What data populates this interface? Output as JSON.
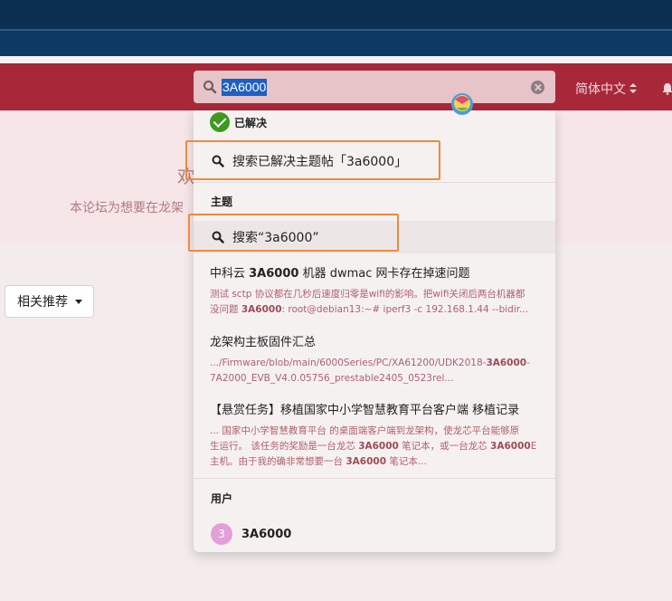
{
  "header": {
    "search": {
      "value": "3A6000"
    },
    "language": "简体中文"
  },
  "banner": {
    "title": "欢迎",
    "subtitle": "本论坛为想要在龙架"
  },
  "sort_button": {
    "label": "相关推荐"
  },
  "dropdown": {
    "solved_label": "已解决",
    "search_solved": "搜索已解决主题帖「3a6000」",
    "topics_heading": "主题",
    "search_topics": "搜索“3a6000”",
    "topics": [
      {
        "title_before": "中科云 ",
        "title_match": "3A6000",
        "title_after": " 机器 dwmac 网卡存在掉速问题",
        "line1": "测试 sctp 协议都在几秒后速度归零是wifi的影响。把wifi关闭后两台机器都",
        "line2_before": "没问题 ",
        "line2_match": "3A6000",
        "line2_after": ": root@debian13:~# iperf3 -c 192.168.1.44 --bidir..."
      },
      {
        "title": "龙架构主板固件汇总",
        "line1_before": ".../Firmware/blob/main/6000Series/PC/XA61200/UDK2018-",
        "line1_match": "3A6000",
        "line1_after": "-",
        "line2": "7A2000_EVB_V4.0.05756_prestable2405_0523rel..."
      },
      {
        "title": "【悬赏任务】移植国家中小学智慧教育平台客户端 移植记录",
        "line1": "... 国家中小学智慧教育平台 的桌面端客户端到龙架构，使龙芯平台能够原",
        "line2_before": "生运行。 该任务的奖励是一台龙芯 ",
        "line2_match": "3A6000",
        "line2_mid": " 笔记本，或一台龙芯 ",
        "line2_match2": "3A6000",
        "line2_after": "E",
        "line3_before": "主机。由于我的确非常想要一台 ",
        "line3_match": "3A6000",
        "line3_after": " 笔记本..."
      }
    ],
    "users_heading": "用户",
    "user": {
      "avatar": "3",
      "name": "3A6000"
    }
  },
  "colors": {
    "header_red": "#a8283a",
    "top_navy": "#0b2f50",
    "highlight_orange": "#ef8a3c",
    "solved_green": "#3d9a1f",
    "selection_blue": "#1d5fc6"
  }
}
